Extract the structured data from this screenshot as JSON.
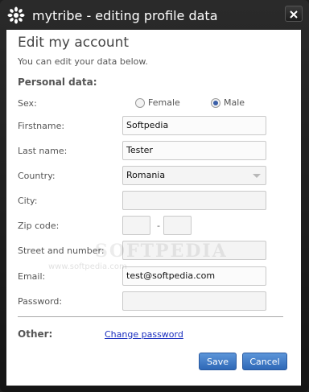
{
  "window": {
    "title": "mytribe - editing profile data",
    "close_icon": "close-icon",
    "logo_icon": "mytribe-logo-icon"
  },
  "header": {
    "heading": "Edit my account",
    "subtitle": "You can edit your data below."
  },
  "personal": {
    "section_title": "Personal data:",
    "sex_label": "Sex:",
    "sex_options": [
      "Female",
      "Male"
    ],
    "sex_selected": "Male",
    "firstname_label": "Firstname:",
    "firstname_value": "Softpedia",
    "lastname_label": "Last name:",
    "lastname_value": "Tester",
    "country_label": "Country:",
    "country_value": "Romania",
    "city_label": "City:",
    "city_value": "",
    "zip_label": "Zip code:",
    "zip_part1": "",
    "zip_separator": "-",
    "zip_part2": "",
    "street_label": "Street and number:",
    "street_value": "",
    "email_label": "Email:",
    "email_value": "test@softpedia.com",
    "password_label": "Password:",
    "password_value": ""
  },
  "other": {
    "label": "Other:",
    "change_password_link": "Change password"
  },
  "buttons": {
    "save": "Save",
    "cancel": "Cancel"
  },
  "watermark": {
    "logo_text": "SOFTPEDIA",
    "url": "www.softpedia.com"
  },
  "colors": {
    "title_bar": "#1f1f1f",
    "button_blue": "#3f7cc8",
    "link_blue": "#1a2fbf",
    "radio_checked": "#3b5fa8"
  }
}
